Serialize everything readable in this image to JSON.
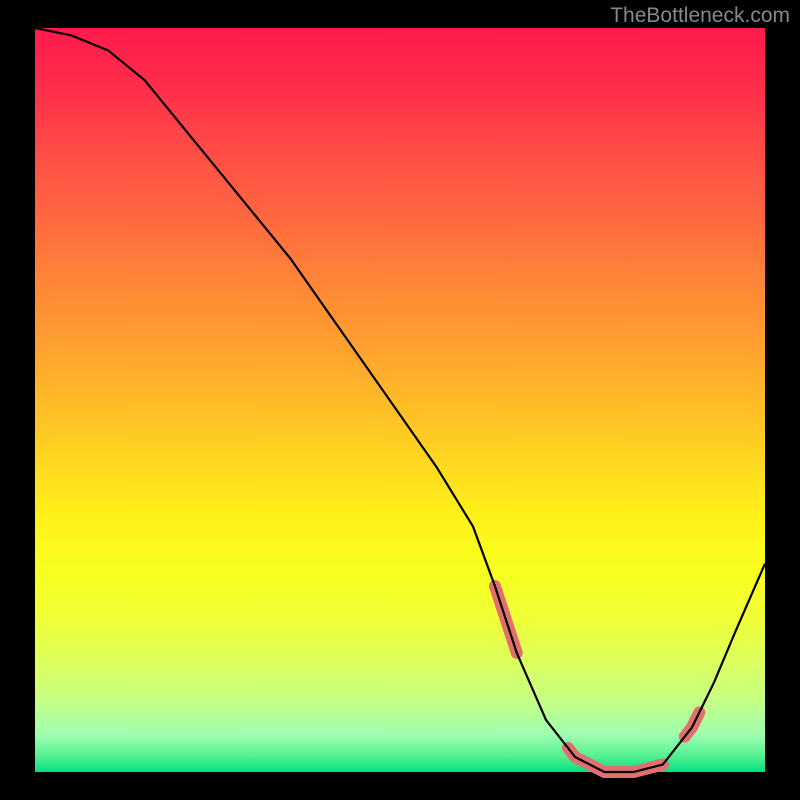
{
  "watermark": "TheBottleneck.com",
  "chart_data": {
    "type": "line",
    "title": "",
    "xlabel": "",
    "ylabel": "",
    "x": [
      0,
      5,
      10,
      15,
      20,
      25,
      30,
      35,
      40,
      45,
      50,
      55,
      60,
      63,
      66,
      70,
      74,
      78,
      82,
      86,
      90,
      93,
      96,
      100
    ],
    "y": [
      100,
      99,
      97,
      93,
      87,
      81,
      75,
      69,
      62,
      55,
      48,
      41,
      33,
      25,
      16,
      7,
      2,
      0,
      0,
      1,
      6,
      12,
      19,
      28
    ],
    "ylim": [
      0,
      100
    ],
    "xlim": [
      0,
      100
    ],
    "highlight_segments": [
      {
        "x_start": 63,
        "x_end": 66
      },
      {
        "x_start": 73,
        "x_end": 86
      },
      {
        "x_start": 89,
        "x_end": 91
      }
    ],
    "highlight_color": "#e26e6e",
    "line_color": "#000000",
    "background": "gradient-red-to-green"
  }
}
